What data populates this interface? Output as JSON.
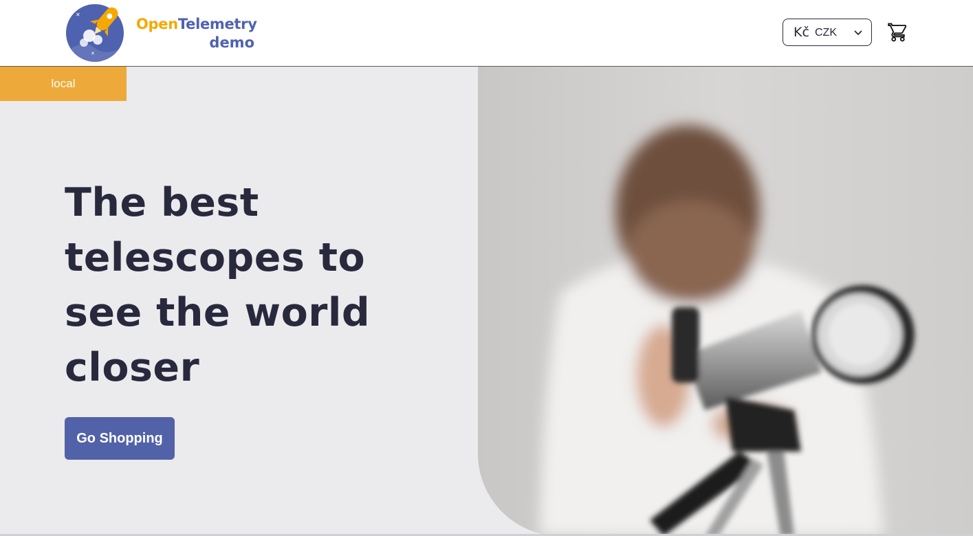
{
  "header": {
    "logo": {
      "word1": "Open",
      "word2": "Telemetry",
      "word3": "demo"
    },
    "currency": {
      "symbol": "Kč",
      "code": "CZK",
      "icon": "chevron-down-icon"
    },
    "cart_icon": "shopping-cart-icon"
  },
  "hero": {
    "badge": "local",
    "headline": "The best telescopes to see the world closer",
    "cta_label": "Go Shopping"
  },
  "colors": {
    "accent_orange": "#f5a800",
    "brand_blue": "#4f62b0",
    "badge": "#eda93a",
    "button": "#5262a8",
    "text_dark": "#29293e",
    "hero_bg": "#ebebed"
  }
}
